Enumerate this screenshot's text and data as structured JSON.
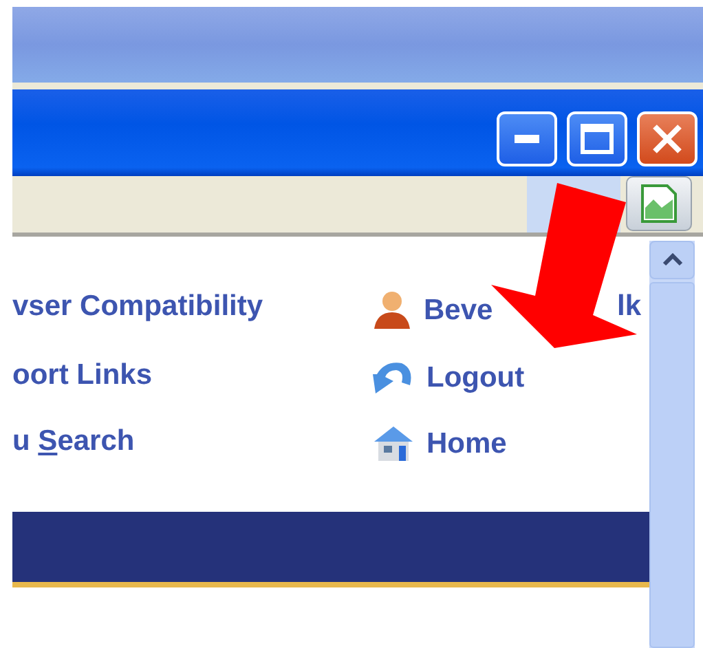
{
  "window": {
    "buttons": [
      {
        "kind": "minimize"
      },
      {
        "kind": "maximize"
      },
      {
        "kind": "close"
      }
    ]
  },
  "links_left": [
    {
      "label": "vser Compatibility"
    },
    {
      "label": "oort Links"
    },
    {
      "label": "u ",
      "access_key": "S",
      "rest": "earch"
    }
  ],
  "links_right": [
    {
      "kind": "user",
      "label": "Beve",
      "label_tail": "lk"
    },
    {
      "kind": "logout",
      "label": "Logout"
    },
    {
      "kind": "home",
      "label": "Home"
    }
  ]
}
